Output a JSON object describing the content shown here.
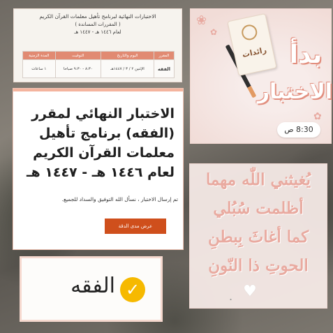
{
  "schedule_card": {
    "heading": "الاختبارات النهائية لبرنامج تأهيل معلمات القرآن الكريم",
    "subheading": "( المقررات المساندة )",
    "year_line": "لعام ١٤٤٦ هـ - ١٤٤٧ هـ",
    "table": {
      "columns": [
        "المقرر",
        "اليوم والتاريخ",
        "التوقيت",
        "المدة الزمنية"
      ],
      "rows": [
        [
          "الفقه",
          "الإثنين ٢ / ٣ / ١٤٤٧هـ",
          "٨:٣٠ - ٩:٣٠ صباحا",
          "١ ساعات"
        ]
      ]
    }
  },
  "start_card": {
    "logo_text": "رائدات",
    "title_line1": "بدأ",
    "title_line2": "الاختبار",
    "time": "8:30 ص"
  },
  "exam_card": {
    "title": "الاختبار النهائي لمقرر (الفقه) برنامج تأهيل معلمات القرآن الكريم لعام ١٤٤٦ هـ - ١٤٤٧ هـ",
    "message": "تم إرسال الاختبار ، نسأل الله التوفيق والسداد للجميع.",
    "button_label": "عرض مدى الدقة"
  },
  "check_card": {
    "label": "الفقه",
    "icon": "check-icon",
    "accent": "#f6b900"
  },
  "dua_card": {
    "line1": "يُغيثني اللّٰه مهما",
    "line2": "أظلمت سُبُلي",
    "line3": "كما أغاثَ بِبطنِ",
    "line4": "الحوتِ ذا النّونِ",
    "icon": "heart-icon"
  },
  "colors": {
    "accent_orange": "#cf4f1c",
    "table_header": "#e18a72",
    "title_pink": "#e28f7f",
    "dua_pink": "#e9aaa0"
  }
}
